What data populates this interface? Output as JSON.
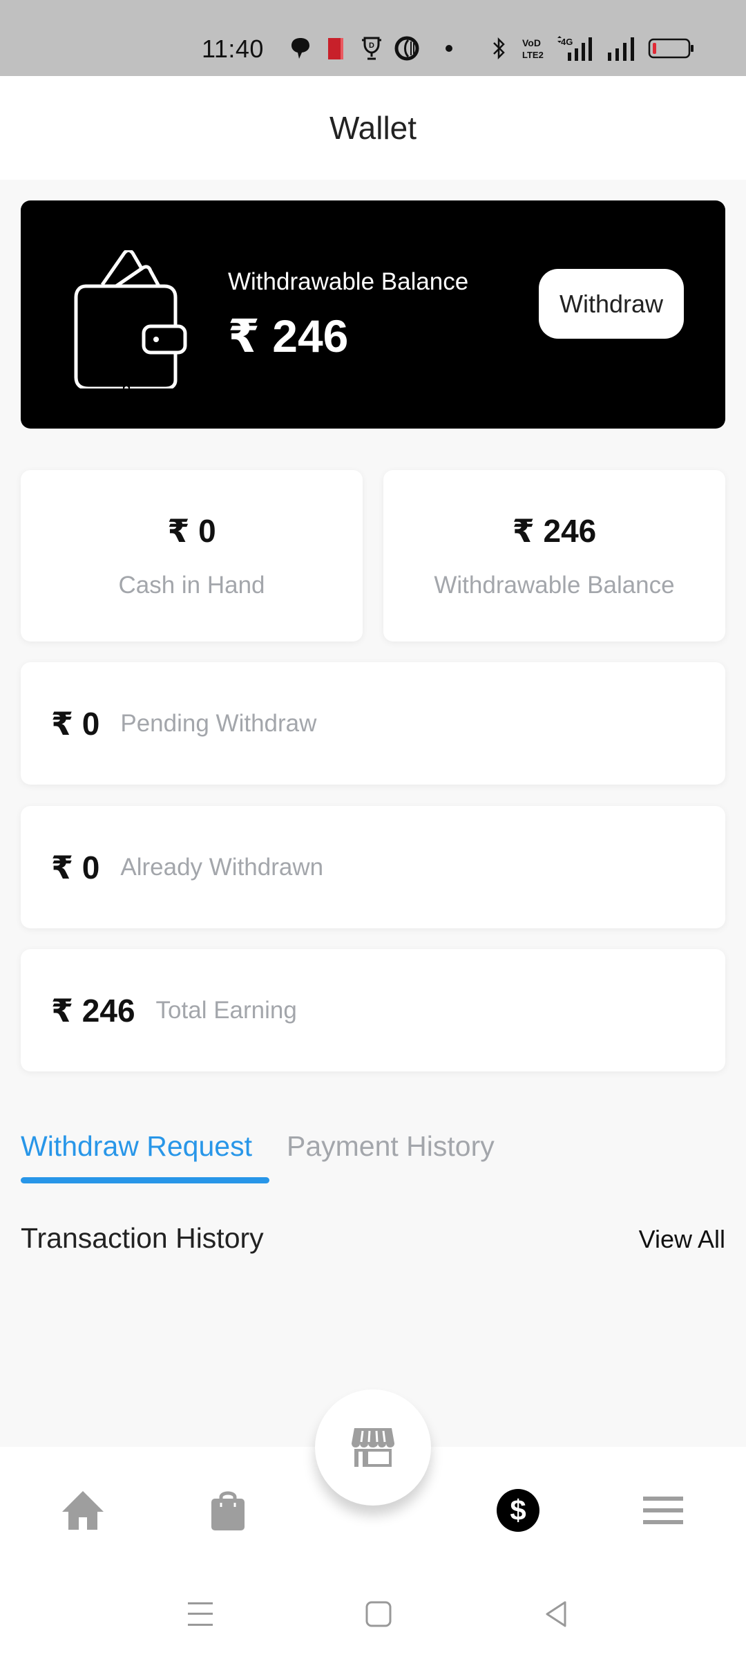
{
  "status_bar": {
    "time": "11:40",
    "icons": [
      "chat-bubble-icon",
      "red-app-icon",
      "trophy-icon",
      "cricket-ball-icon",
      "dot-icon",
      "bluetooth-icon",
      "volte-icon",
      "4g-signal-icon",
      "signal-icon",
      "battery-low-icon"
    ],
    "network_label": "4G",
    "volte_label": "VoLTE2"
  },
  "header": {
    "title": "Wallet"
  },
  "balance_card": {
    "label": "Withdrawable Balance",
    "amount": "₹ 246",
    "button_label": "Withdraw",
    "icon": "wallet-icon"
  },
  "stats_small": [
    {
      "amount": "₹ 0",
      "label": "Cash in Hand"
    },
    {
      "amount": "₹ 246",
      "label": "Withdrawable Balance"
    }
  ],
  "stats_wide": [
    {
      "amount": "₹ 0",
      "label": "Pending Withdraw"
    },
    {
      "amount": "₹ 0",
      "label": "Already Withdrawn"
    },
    {
      "amount": "₹ 246",
      "label": "Total Earning"
    }
  ],
  "tabs": [
    {
      "label": "Withdraw Request",
      "active": true
    },
    {
      "label": "Payment History",
      "active": false
    }
  ],
  "transactions": {
    "title": "Transaction History",
    "view_all": "View All"
  },
  "bottom_nav": {
    "items": [
      {
        "icon": "home-icon",
        "active": false
      },
      {
        "icon": "shopping-bag-icon",
        "active": false
      },
      {
        "icon": "store-icon",
        "active": false,
        "center": true
      },
      {
        "icon": "dollar-icon",
        "active": true
      },
      {
        "icon": "menu-icon",
        "active": false
      }
    ]
  },
  "system_nav": [
    "recents-icon",
    "home-square-icon",
    "back-icon"
  ],
  "colors": {
    "accent": "#2896e8",
    "inactive_text": "#a3a6ab",
    "card_dark": "#000000",
    "nav_icon": "#9e9e9e",
    "battery_low": "#e02a36"
  }
}
